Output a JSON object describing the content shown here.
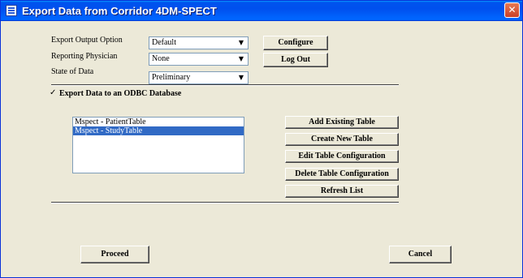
{
  "window": {
    "title": "Export Data from Corridor 4DM-SPECT"
  },
  "fields": {
    "export_output_option": {
      "label": "Export Output Option",
      "value": "Default"
    },
    "reporting_physician": {
      "label": "Reporting Physician",
      "value": "None"
    },
    "state_of_data": {
      "label": "State of Data",
      "value": "Preliminary"
    }
  },
  "buttons": {
    "configure": "Configure",
    "log_out": "Log Out",
    "add_existing_table": "Add Existing Table",
    "create_new_table": "Create New Table",
    "edit_table_configuration": "Edit Table Configuration",
    "delete_table_configuration": "Delete Table Configuration",
    "refresh_list": "Refresh List",
    "proceed": "Proceed",
    "cancel": "Cancel"
  },
  "odbc": {
    "label": "Export Data to an ODBC Database",
    "checked": true,
    "check_glyph": "✓"
  },
  "tables": [
    {
      "name": "Mspect - PatientTable",
      "selected": false
    },
    {
      "name": "Mspect - StudyTable",
      "selected": true
    }
  ],
  "icons": {
    "close": "close-icon",
    "app": "app-icon",
    "dropdown": "chevron-down-icon"
  }
}
